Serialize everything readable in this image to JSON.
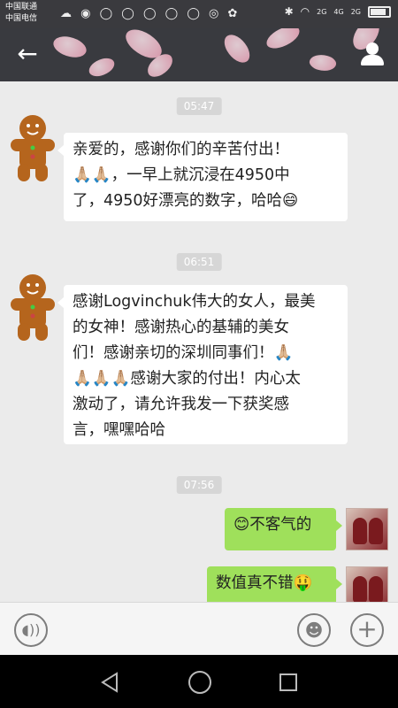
{
  "status_bar": {
    "carrier_1": "中国联通",
    "carrier_2": "中国电信",
    "signal_1": "2G",
    "signal_2": "4G",
    "signal_3": "2G"
  },
  "nav": {
    "back_icon": "arrow-left-icon",
    "profile_icon": "person-icon",
    "bg_color": "#393a3f"
  },
  "messages": [
    {
      "type": "time",
      "text": "05:47"
    },
    {
      "type": "received",
      "avatar": "gingerbread-man",
      "lines": [
        "亲爱的，感谢你们的辛苦付出！",
        "🙏🏼🙏🏼，一早上就沉浸在4950中",
        "了，4950好漂亮的数字，哈哈😄"
      ]
    },
    {
      "type": "time",
      "text": "06:51"
    },
    {
      "type": "received",
      "avatar": "gingerbread-man",
      "lines": [
        "感谢Logvinchuk伟大的女人，最美",
        "的女神！感谢热心的基辅的美女",
        "们！感谢亲切的深圳同事们！🙏🏼",
        "🙏🏼🙏🏼🙏🏼感谢大家的付出！内心太",
        "激动了，请允许我发一下获奖感",
        "言，嘿嘿哈哈"
      ]
    },
    {
      "type": "time",
      "text": "07:56"
    },
    {
      "type": "sent",
      "avatar": "photo",
      "lines": [
        "😊不客气的"
      ]
    },
    {
      "type": "sent",
      "avatar": "photo",
      "lines": [
        "数值真不错🤑"
      ]
    }
  ],
  "input_bar": {
    "voice_icon": "voice-icon",
    "emoji_icon": "emoji-icon",
    "plus_icon": "plus-icon"
  },
  "colors": {
    "chat_bg": "#ebebeb",
    "sent_bubble": "#9fe05b",
    "received_bubble": "#ffffff"
  }
}
